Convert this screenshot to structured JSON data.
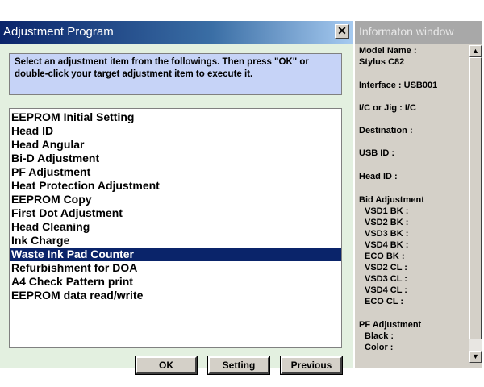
{
  "main_window": {
    "title": "Adjustment Program",
    "close_symbol": "✕",
    "instruction": "Select an adjustment item from the followings. Then press \"OK\" or double-click your target adjustment item to execute it.",
    "items": [
      {
        "label": "EEPROM Initial Setting"
      },
      {
        "label": "Head ID"
      },
      {
        "label": "Head Angular"
      },
      {
        "label": "Bi-D Adjustment"
      },
      {
        "label": "PF Adjustment"
      },
      {
        "label": "Heat Protection Adjustment"
      },
      {
        "label": "EEPROM Copy"
      },
      {
        "label": "First Dot Adjustment"
      },
      {
        "label": "Head Cleaning"
      },
      {
        "label": "Ink Charge"
      },
      {
        "label": "Waste Ink Pad Counter",
        "selected": true
      },
      {
        "label": "Refurbishment for DOA"
      },
      {
        "label": "A4 Check Pattern print"
      },
      {
        "label": "EEPROM data read/write"
      }
    ],
    "buttons": {
      "ok": "OK",
      "setting": "Setting",
      "previous": "Previous"
    }
  },
  "info_window": {
    "title": "Informaton window",
    "model_label": "Model Name :",
    "model_value": "Stylus C82",
    "interface": "Interface : USB001",
    "ic_jig": "I/C or Jig : I/C",
    "destination": "Destination :",
    "usb_id": "USB ID :",
    "head_id": "Head ID :",
    "bid_adjustment": "Bid Adjustment",
    "bid_fields": [
      "VSD1 BK :",
      "VSD2 BK :",
      "VSD3 BK :",
      "VSD4 BK :",
      "ECO BK :",
      "VSD2 CL :",
      "VSD3 CL :",
      "VSD4 CL :",
      "ECO CL :"
    ],
    "pf_adjustment": "PF Adjustment",
    "pf_fields": [
      "Black :",
      "Color :"
    ],
    "scroll_up": "▲",
    "scroll_down": "▼"
  },
  "colors": {
    "titlebar": "#0a246a",
    "selection": "#0a246a",
    "instruction_bg": "#c6d3f7",
    "window_bg": "#e3f0e0"
  }
}
